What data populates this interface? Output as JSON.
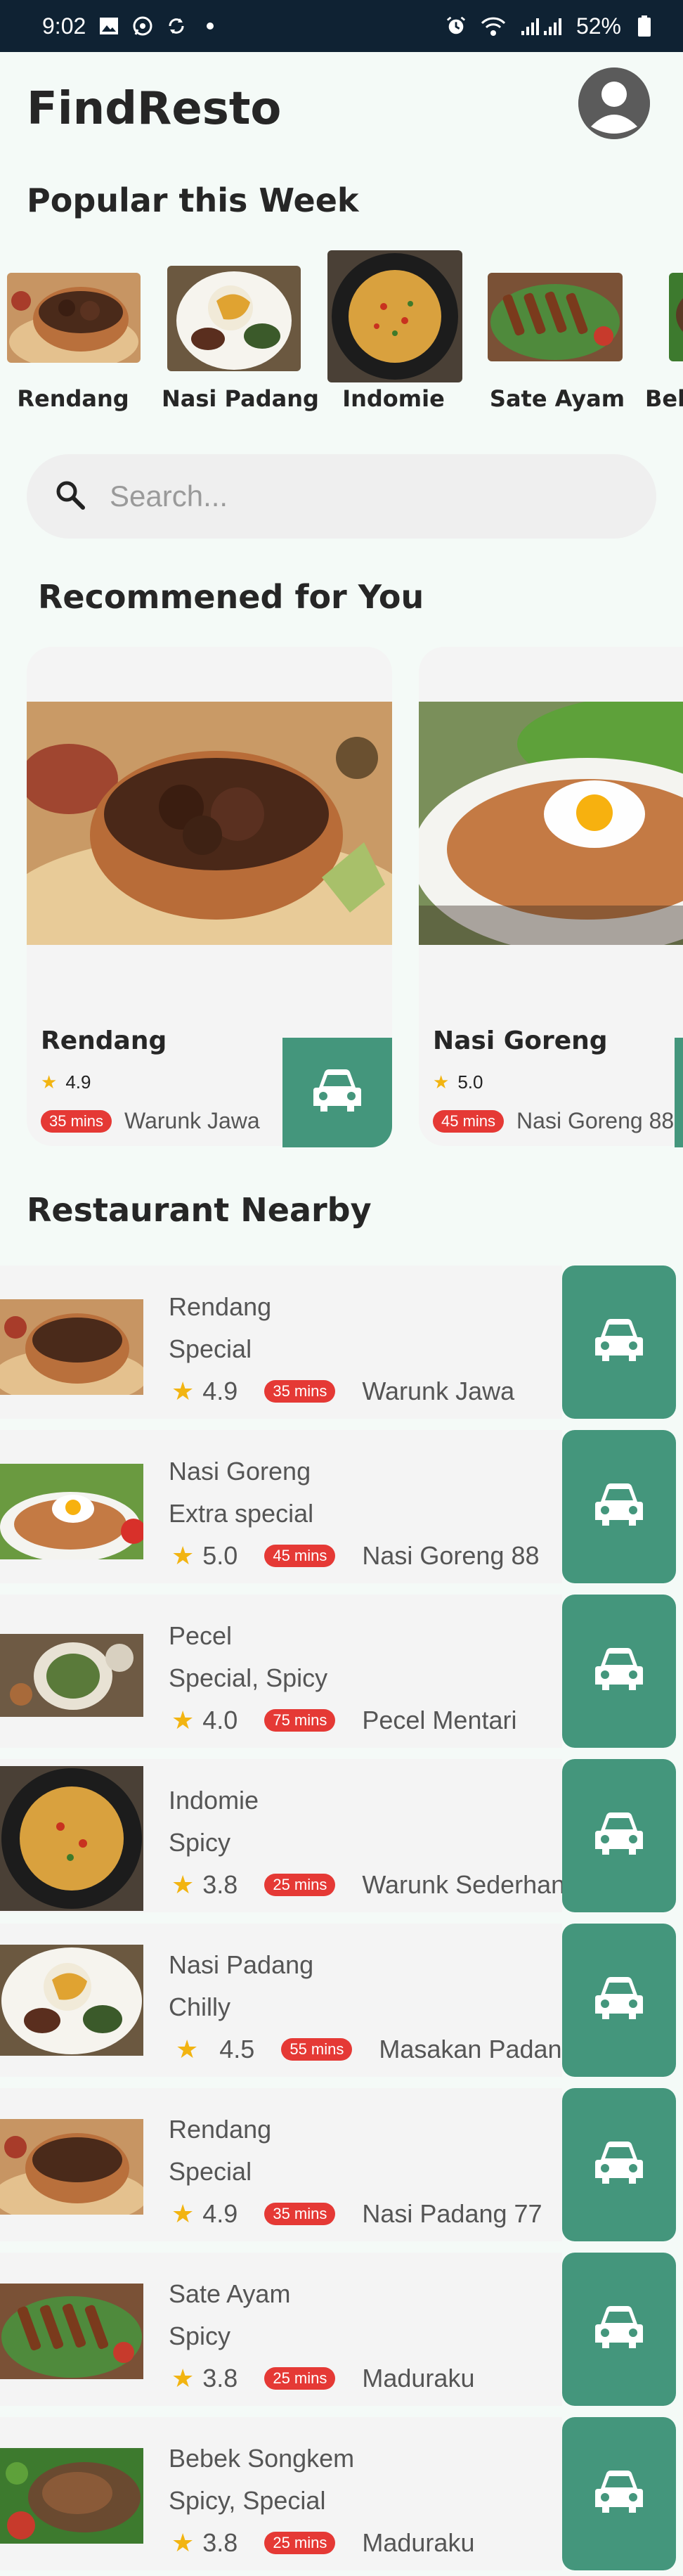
{
  "status_bar": {
    "time": "9:02",
    "battery": "52%",
    "icons": [
      "image-icon",
      "whatsapp-icon",
      "sync-icon",
      "dot-icon",
      "alarm-icon",
      "wifi-icon",
      "signal-icon",
      "battery-icon"
    ]
  },
  "app": {
    "title": "FindResto"
  },
  "popular": {
    "title": "Popular this Week",
    "items": [
      {
        "label": "Rendang"
      },
      {
        "label": "Nasi Padang"
      },
      {
        "label": "Indomie"
      },
      {
        "label": "Sate Ayam"
      },
      {
        "label": "Bebek Songkem"
      }
    ]
  },
  "search": {
    "placeholder": "Search..."
  },
  "recommended": {
    "title": "Recommened for You",
    "items": [
      {
        "name": "Rendang",
        "rating": "4.9",
        "time": "35 mins",
        "resto": "Warunk Jawa"
      },
      {
        "name": "Nasi Goreng",
        "rating": "5.0",
        "time": "45 mins",
        "resto": "Nasi Goreng 88"
      }
    ]
  },
  "nearby": {
    "title": "Restaurant Nearby",
    "items": [
      {
        "name": "Rendang",
        "desc": "Special",
        "rating": "4.9",
        "time": "35 mins",
        "resto": "Warunk Jawa"
      },
      {
        "name": "Nasi Goreng",
        "desc": "Extra special",
        "rating": "5.0",
        "time": "45 mins",
        "resto": "Nasi Goreng 88"
      },
      {
        "name": "Pecel",
        "desc": "Special, Spicy",
        "rating": "4.0",
        "time": "75 mins",
        "resto": "Pecel Mentari"
      },
      {
        "name": "Indomie",
        "desc": "Spicy",
        "rating": "3.8",
        "time": "25 mins",
        "resto": "Warunk Sederhana"
      },
      {
        "name": "Nasi Padang",
        "desc": "Chilly",
        "rating": "4.5",
        "time": "55 mins",
        "resto": "Masakan Padang"
      },
      {
        "name": "Rendang",
        "desc": "Special",
        "rating": "4.9",
        "time": "35 mins",
        "resto": "Nasi Padang 77"
      },
      {
        "name": "Sate Ayam",
        "desc": "Spicy",
        "rating": "3.8",
        "time": "25 mins",
        "resto": "Maduraku"
      },
      {
        "name": "Bebek Songkem",
        "desc": "Spicy, Special",
        "rating": "3.8",
        "time": "25 mins",
        "resto": "Maduraku"
      }
    ]
  },
  "colors": {
    "accent": "#44967c",
    "badge": "#e53935",
    "star": "#f2b411",
    "status_bar": "#0f2233"
  }
}
